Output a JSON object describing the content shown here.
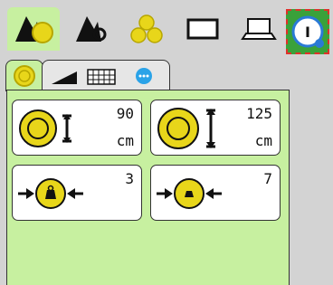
{
  "toolbar": {
    "buttons": [
      {
        "name": "bale-machine-tab",
        "icon": "bale-machine-icon"
      },
      {
        "name": "tractor-settings-tab",
        "icon": "machine-tool-icon"
      },
      {
        "name": "bale-stack-tab",
        "icon": "bale-stack-icon"
      },
      {
        "name": "display-tab",
        "icon": "monitor-icon"
      },
      {
        "name": "laptop-tab",
        "icon": "laptop-icon"
      },
      {
        "name": "info-settings-tab",
        "icon": "info-gear-icon"
      }
    ]
  },
  "tabs": [
    {
      "name": "bale-tab",
      "icon": "bale-icon",
      "active": true
    },
    {
      "name": "knife-net-tab",
      "icon": "knife-net-icon",
      "active": false
    },
    {
      "name": "more-tab",
      "icon": "more-dots-icon",
      "active": false
    }
  ],
  "cards": {
    "bale_diameter_small": {
      "value": "90",
      "unit": "cm"
    },
    "bale_diameter_large": {
      "value": "125",
      "unit": "cm"
    },
    "density_small": {
      "value": "3"
    },
    "density_large": {
      "value": "7"
    }
  },
  "colors": {
    "panel_green": "#c7f0a0",
    "bale_yellow": "#e8d61a",
    "selected_green": "#3aa13a",
    "highlight_red": "#e0302a",
    "info_blue": "#2a7ad6"
  }
}
